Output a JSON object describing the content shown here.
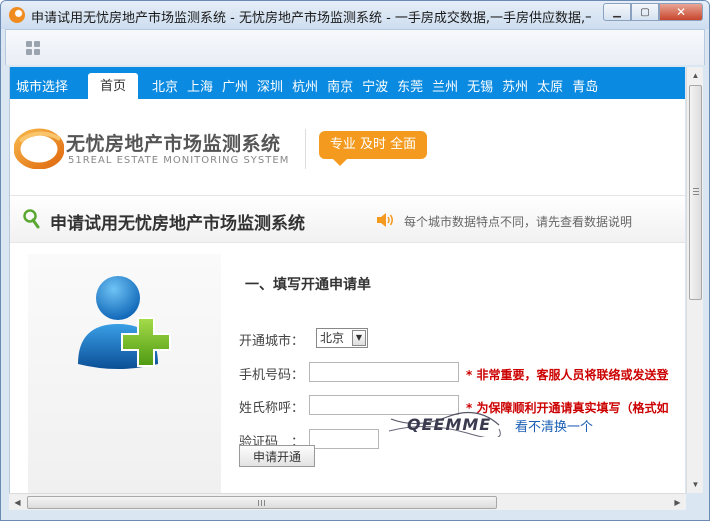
{
  "window": {
    "title": "申请试用无忧房地产市场监测系统 - 无忧房地产市场监测系统 - 一手房成交数据,一手房供应数据,一手房...",
    "minimize_glyph": "▁",
    "maximize_glyph": "▢",
    "close_glyph": "✕"
  },
  "nav": {
    "city_select_label": "城市选择",
    "home_tab": "首页",
    "cities": [
      "北京",
      "上海",
      "广州",
      "深圳",
      "杭州",
      "南京",
      "宁波",
      "东莞",
      "兰州",
      "无锡",
      "苏州",
      "太原",
      "青岛"
    ]
  },
  "header": {
    "logo_cn": "无忧房地产市场监测系统",
    "logo_en": "51REAL ESTATE MONITORING SYSTEM",
    "slogan": "专业 及时 全面"
  },
  "section": {
    "title": "申请试用无忧房地产市场监测系统",
    "notice": "每个城市数据特点不同，请先查看数据说明"
  },
  "form": {
    "heading": "一、填写开通申请单",
    "city_label": "开通城市：",
    "city_value": "北京",
    "phone_label": "手机号码：",
    "phone_value": "",
    "phone_hint": "* 非常重要，客服人员将联络或发送登",
    "name_label": "姓氏称呼：",
    "name_value": "",
    "name_hint": "* 为保障顺利开通请真实填写（格式如",
    "captcha_label": "验证码　：",
    "captcha_value": "",
    "captcha_text": "QEEMME",
    "captcha_refresh": "看不清换一个",
    "submit_label": "申请开通"
  },
  "scrollbars": {
    "up": "▲",
    "down": "▼",
    "left": "◀",
    "right": "▶"
  }
}
